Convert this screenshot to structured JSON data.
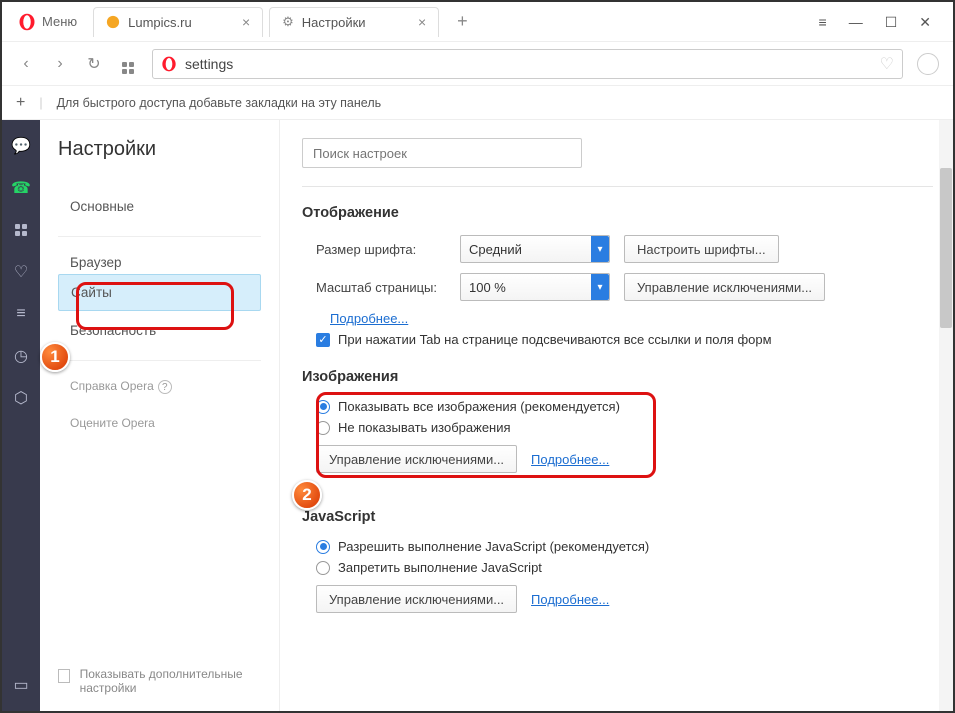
{
  "menu_label": "Меню",
  "tabs": [
    {
      "title": "Lumpics.ru",
      "active": false
    },
    {
      "title": "Настройки",
      "active": true
    }
  ],
  "window": {
    "min": "—",
    "max": "☐",
    "close": "✕",
    "stack": "≡"
  },
  "address": {
    "value": "settings"
  },
  "bookbar": "Для быстрого доступа добавьте закладки на эту панель",
  "settings": {
    "title": "Настройки",
    "nav": {
      "basic": "Основные",
      "browser": "Браузер",
      "sites": "Сайты",
      "security": "Безопасность",
      "help": "Справка Opera",
      "rate": "Оцените Opera"
    },
    "show_advanced": "Показывать дополнительные настройки",
    "search_placeholder": "Поиск настроек",
    "display": {
      "title": "Отображение",
      "font_size_label": "Размер шрифта:",
      "font_size_value": "Средний",
      "font_btn": "Настроить шрифты...",
      "zoom_label": "Масштаб страницы:",
      "zoom_value": "100 %",
      "zoom_btn": "Управление исключениями...",
      "more": "Подробнее...",
      "tab_hint": "При нажатии Tab на странице подсвечиваются все ссылки и поля форм"
    },
    "images": {
      "title": "Изображения",
      "opt_show": "Показывать все изображения (рекомендуется)",
      "opt_hide": "Не показывать изображения",
      "btn": "Управление исключениями...",
      "more": "Подробнее..."
    },
    "js": {
      "title": "JavaScript",
      "opt_allow": "Разрешить выполнение JavaScript (рекомендуется)",
      "opt_block": "Запретить выполнение JavaScript",
      "btn": "Управление исключениями...",
      "more": "Подробнее..."
    }
  },
  "badges": {
    "one": "1",
    "two": "2"
  }
}
